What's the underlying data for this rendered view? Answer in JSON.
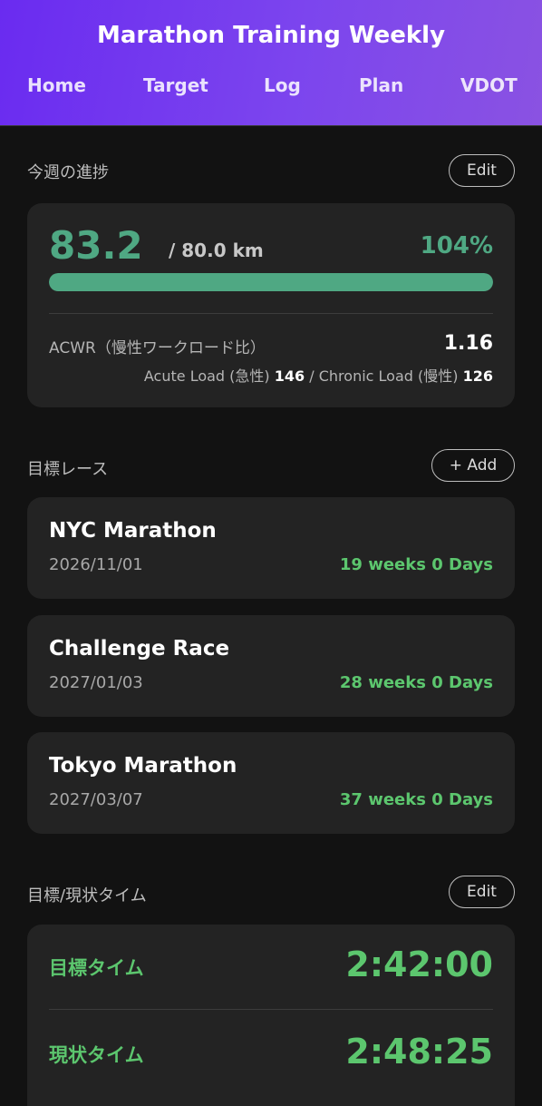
{
  "header": {
    "title": "Marathon Training Weekly",
    "nav": [
      "Home",
      "Target",
      "Log",
      "Plan",
      "VDOT"
    ]
  },
  "weekly_progress": {
    "section_title": "今週の進捗",
    "edit_label": "Edit",
    "distance": "83.2",
    "target": "/ 80.0 km",
    "percent_label": "104%",
    "progress_fraction": 1.0,
    "acwr_label": "ACWR（慢性ワークロード比）",
    "acwr_value": "1.16",
    "acute_label": "Acute Load (急性)",
    "acute_value": "146",
    "separator": "/",
    "chronic_label": "Chronic Load (慢性)",
    "chronic_value": "126"
  },
  "target_races": {
    "section_title": "目標レース",
    "add_label": "+ Add",
    "races": [
      {
        "name": "NYC Marathon",
        "date": "2026/11/01",
        "countdown": "19 weeks 0 Days"
      },
      {
        "name": "Challenge Race",
        "date": "2027/01/03",
        "countdown": "28 weeks 0 Days"
      },
      {
        "name": "Tokyo Marathon",
        "date": "2027/03/07",
        "countdown": "37 weeks 0 Days"
      }
    ]
  },
  "times": {
    "section_title": "目標/現状タイム",
    "edit_label": "Edit",
    "target_label": "目標タイム",
    "target_time": "2:42:00",
    "current_label": "現状タイム",
    "current_time": "2:48:25"
  },
  "colors": {
    "accent_green": "#4fa883",
    "countdown_green": "#5cc66e",
    "header_gradient_start": "#6a2bf0",
    "header_gradient_end": "#8a52e2"
  }
}
